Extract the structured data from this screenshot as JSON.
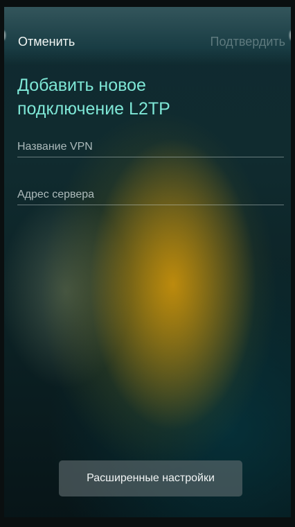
{
  "header": {
    "cancel_label": "Отменить",
    "confirm_label": "Подтвердить"
  },
  "page": {
    "title_line1": "Добавить новое",
    "title_line2": "подключение L2TP"
  },
  "form": {
    "vpn_name": {
      "value": "",
      "placeholder": "Название VPN"
    },
    "server_address": {
      "value": "",
      "placeholder": "Адрес сервера"
    }
  },
  "footer": {
    "advanced_label": "Расширенные настройки"
  },
  "colors": {
    "accent": "#7ee7d6",
    "header_bg": "#375a60",
    "button_bg": "#5f6c70"
  }
}
